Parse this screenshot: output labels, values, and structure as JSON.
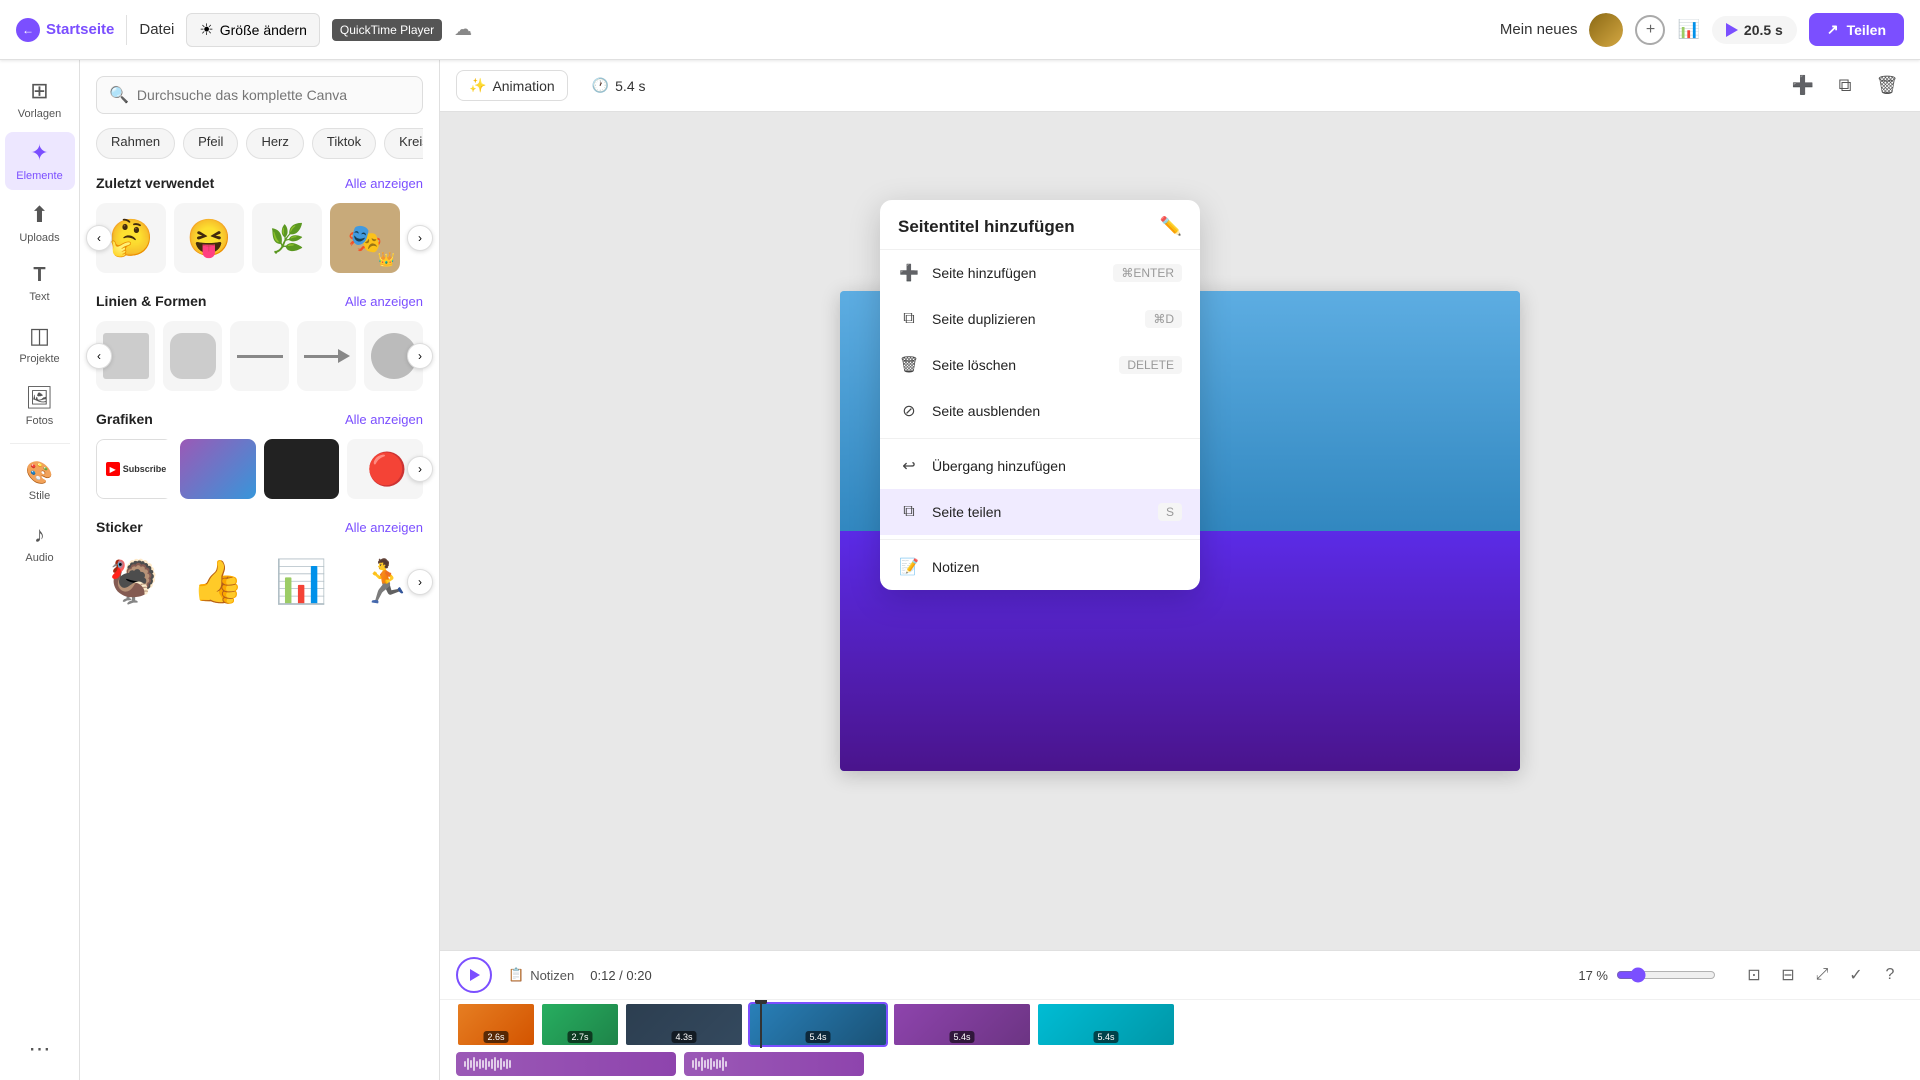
{
  "topbar": {
    "home_label": "Startseite",
    "datei_label": "Datei",
    "groesse_label": "Größe ändern",
    "qt_badge": "QuickTime Player",
    "title": "Mein neues",
    "timer": "20.5 s",
    "share_label": "Teilen"
  },
  "sidebar": {
    "items": [
      {
        "id": "vorlagen",
        "label": "Vorlagen",
        "icon": "⊞"
      },
      {
        "id": "elemente",
        "label": "Elemente",
        "icon": "✦"
      },
      {
        "id": "uploads",
        "label": "Uploads",
        "icon": "⬆"
      },
      {
        "id": "text",
        "label": "Text",
        "icon": "T"
      },
      {
        "id": "projekte",
        "label": "Projekte",
        "icon": "◫"
      },
      {
        "id": "fotos",
        "label": "Fotos",
        "icon": "🖼"
      },
      {
        "id": "stile",
        "label": "Stile",
        "icon": "🎨"
      },
      {
        "id": "audio",
        "label": "Audio",
        "icon": "♪"
      }
    ]
  },
  "left_panel": {
    "search_placeholder": "Durchsuche das komplette Canva",
    "filter_chips": [
      "Rahmen",
      "Pfeil",
      "Herz",
      "Tiktok",
      "Kreis"
    ],
    "recently_used": {
      "title": "Zuletzt verwendet",
      "see_all": "Alle anzeigen"
    },
    "lines_shapes": {
      "title": "Linien & Formen",
      "see_all": "Alle anzeigen"
    },
    "grafiken": {
      "title": "Grafiken",
      "see_all": "Alle anzeigen"
    },
    "sticker": {
      "title": "Sticker",
      "see_all": "Alle anzeigen"
    }
  },
  "toolbar": {
    "animation_label": "Animation",
    "duration_label": "5.4 s"
  },
  "context_menu": {
    "title": "Seitentitel hinzufügen",
    "items": [
      {
        "id": "add_page",
        "label": "Seite hinzufügen",
        "shortcut": "⌘ENTER",
        "icon": "➕"
      },
      {
        "id": "duplicate_page",
        "label": "Seite duplizieren",
        "shortcut": "⌘D",
        "icon": "⧉"
      },
      {
        "id": "delete_page",
        "label": "Seite löschen",
        "shortcut": "DELETE",
        "icon": "🗑"
      },
      {
        "id": "hide_page",
        "label": "Seite ausblenden",
        "shortcut": "",
        "icon": "⊘"
      },
      {
        "id": "add_transition",
        "label": "Übergang hinzufügen",
        "shortcut": "",
        "icon": "⟳"
      },
      {
        "id": "split_page",
        "label": "Seite teilen",
        "shortcut": "S",
        "icon": "⧉"
      },
      {
        "id": "notes",
        "label": "Notizen",
        "shortcut": "",
        "icon": "📝"
      }
    ]
  },
  "timeline": {
    "notizen_label": "Notizen",
    "time_display": "0:12 / 0:20",
    "zoom_percent": "17 %",
    "thumbs": [
      {
        "duration": "2.6s",
        "active": false
      },
      {
        "duration": "2.7s",
        "active": false
      },
      {
        "duration": "4.3s",
        "active": false
      },
      {
        "duration": "5.4s",
        "active": true
      },
      {
        "duration": "5.4s",
        "active": false
      },
      {
        "duration": "5.4s",
        "active": false
      }
    ]
  }
}
